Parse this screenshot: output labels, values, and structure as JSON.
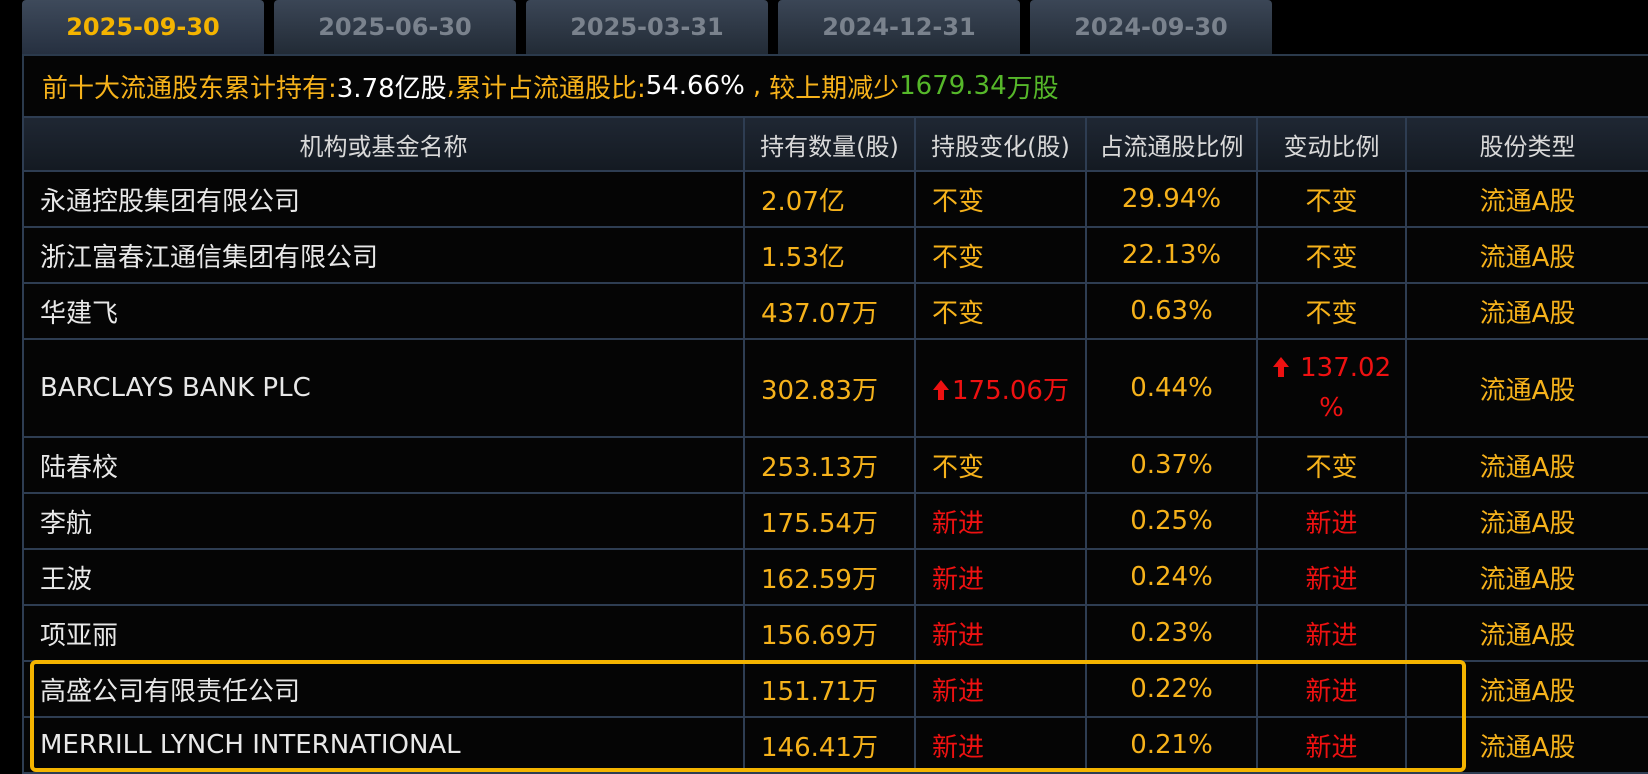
{
  "tabs": [
    {
      "label": "2025-09-30",
      "active": true
    },
    {
      "label": "2025-06-30",
      "active": false
    },
    {
      "label": "2025-03-31",
      "active": false
    },
    {
      "label": "2024-12-31",
      "active": false
    },
    {
      "label": "2024-09-30",
      "active": false
    }
  ],
  "summary": {
    "label_hold": "前十大流通股东累计持有:",
    "hold_value": "3.78亿股",
    "sep1": ",",
    "label_ratio": "累计占流通股比:",
    "ratio_value": "54.66%",
    "sep2": ",",
    "label_change": "较上期减少",
    "change_value": "1679.34",
    "change_unit": "万股"
  },
  "table": {
    "headers": [
      "机构或基金名称",
      "持有数量(股)",
      "持股变化(股)",
      "占流通股比例",
      "变动比例",
      "股份类型"
    ],
    "rows": [
      {
        "name": "永通控股集团有限公司",
        "qty": "2.07亿",
        "chg": "不变",
        "ratio": "29.94%",
        "chg_ratio": "不变",
        "type": "流通A股"
      },
      {
        "name": "浙江富春江通信集团有限公司",
        "qty": "1.53亿",
        "chg": "不变",
        "ratio": "22.13%",
        "chg_ratio": "不变",
        "type": "流通A股"
      },
      {
        "name": "华建飞",
        "qty": "437.07万",
        "chg": "不变",
        "ratio": "0.63%",
        "chg_ratio": "不变",
        "type": "流通A股"
      },
      {
        "name": "BARCLAYS BANK PLC",
        "qty": "302.83万",
        "chg": "175.06万",
        "ratio": "0.44%",
        "chg_ratio_line1": "137.02",
        "chg_ratio_line2": "%",
        "type": "流通A股"
      },
      {
        "name": "陆春校",
        "qty": "253.13万",
        "chg": "不变",
        "ratio": "0.37%",
        "chg_ratio": "不变",
        "type": "流通A股"
      },
      {
        "name": "李航",
        "qty": "175.54万",
        "chg": "新进",
        "ratio": "0.25%",
        "chg_ratio": "新进",
        "type": "流通A股"
      },
      {
        "name": "王波",
        "qty": "162.59万",
        "chg": "新进",
        "ratio": "0.24%",
        "chg_ratio": "新进",
        "type": "流通A股"
      },
      {
        "name": "项亚丽",
        "qty": "156.69万",
        "chg": "新进",
        "ratio": "0.23%",
        "chg_ratio": "新进",
        "type": "流通A股"
      },
      {
        "name": "高盛公司有限责任公司",
        "qty": "151.71万",
        "chg": "新进",
        "ratio": "0.22%",
        "chg_ratio": "新进",
        "type": "流通A股"
      },
      {
        "name": "MERRILL LYNCH INTERNATIONAL",
        "qty": "146.41万",
        "chg": "新进",
        "ratio": "0.21%",
        "chg_ratio": "新进",
        "type": "流通A股"
      }
    ]
  },
  "colors": {
    "accent": "#f4b400",
    "value": "#f6b21b",
    "increase": "#ee1111",
    "decrease": "#56b82a",
    "border": "#2e3d52"
  },
  "icons": {
    "increase": "up-arrow-icon"
  }
}
